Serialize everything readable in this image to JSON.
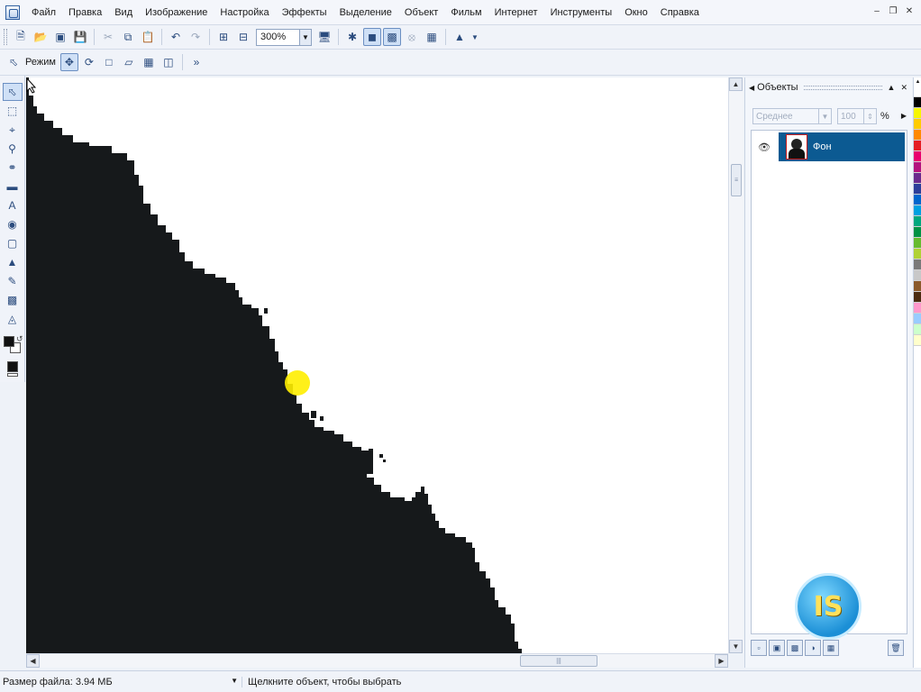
{
  "menu": {
    "items": [
      {
        "label": "Файл"
      },
      {
        "label": "Правка"
      },
      {
        "label": "Вид"
      },
      {
        "label": "Изображение"
      },
      {
        "label": "Настройка"
      },
      {
        "label": "Эффекты"
      },
      {
        "label": "Выделение"
      },
      {
        "label": "Объект"
      },
      {
        "label": "Фильм"
      },
      {
        "label": "Интернет"
      },
      {
        "label": "Инструменты"
      },
      {
        "label": "Окно"
      },
      {
        "label": "Справка"
      }
    ]
  },
  "toolbar": {
    "zoom_value": "300%"
  },
  "property_bar": {
    "mode_label": "Режим"
  },
  "objects_docker": {
    "title": "Объекты",
    "blend_mode": "Среднее",
    "opacity": "100",
    "opacity_unit": "%",
    "layers": [
      {
        "name": "Фон",
        "selected": true,
        "visible": true
      }
    ]
  },
  "status": {
    "file_size": "Размер файла: 3.94 МБ",
    "hint": "Щелкните объект, чтобы выбрать"
  },
  "logo": {
    "text": "IS"
  },
  "colors": {
    "canvas_fill": "#16191b",
    "selection": "#0c5a92",
    "cursor_highlight": "#ffee00",
    "palette": [
      "#ffffff",
      "#000000",
      "#f6f600",
      "#ffcc00",
      "#ff8a00",
      "#e51e25",
      "#e8006e",
      "#b3127e",
      "#6a2a8e",
      "#2c3e9a",
      "#0066cc",
      "#00a0e0",
      "#00a77e",
      "#009245",
      "#66bb2f",
      "#b0d235",
      "#7a7a7a",
      "#c8c8c8",
      "#8b5a2b",
      "#4a2b10",
      "#ff99cc",
      "#99ccff",
      "#ccffcc",
      "#ffffcc"
    ]
  }
}
